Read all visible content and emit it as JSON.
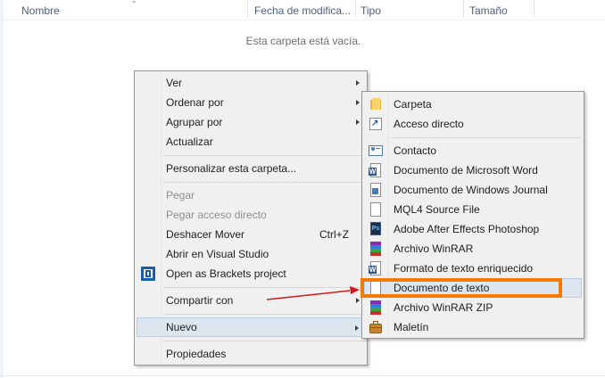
{
  "explorer": {
    "columns": [
      "Nombre",
      "Fecha de modifica...",
      "Tipo",
      "Tamaño"
    ],
    "empty_message": "Esta carpeta está vacía."
  },
  "context_menu": {
    "items": [
      {
        "label": "Ver",
        "submenu": true
      },
      {
        "label": "Ordenar por",
        "submenu": true
      },
      {
        "label": "Agrupar por",
        "submenu": true
      },
      {
        "label": "Actualizar"
      },
      {
        "label": "Personalizar esta carpeta..."
      },
      {
        "label": "Pegar",
        "disabled": true
      },
      {
        "label": "Pegar acceso directo",
        "disabled": true
      },
      {
        "label": "Deshacer Mover",
        "shortcut": "Ctrl+Z"
      },
      {
        "label": "Abrir en Visual Studio"
      },
      {
        "label": "Open as Brackets project",
        "icon": "brackets-icon"
      },
      {
        "label": "Compartir con",
        "submenu": true
      },
      {
        "label": "Nuevo",
        "submenu": true,
        "highlighted": true
      },
      {
        "label": "Propiedades"
      }
    ]
  },
  "new_submenu": {
    "items": [
      {
        "label": "Carpeta",
        "icon": "folder-icon"
      },
      {
        "label": "Acceso directo",
        "icon": "shortcut-icon"
      },
      {
        "label": "Contacto",
        "icon": "contact-icon"
      },
      {
        "label": "Documento de Microsoft Word",
        "icon": "word-document-icon"
      },
      {
        "label": "Documento de Windows Journal",
        "icon": "journal-document-icon"
      },
      {
        "label": "MQL4 Source File",
        "icon": "blank-document-icon"
      },
      {
        "label": "Adobe After Effects Photoshop",
        "icon": "photoshop-icon"
      },
      {
        "label": "Archivo WinRAR",
        "icon": "winrar-icon"
      },
      {
        "label": "Formato de texto enriquecido",
        "icon": "rtf-document-icon"
      },
      {
        "label": "Documento de texto",
        "icon": "text-document-icon",
        "highlighted": true
      },
      {
        "label": "Archivo WinRAR ZIP",
        "icon": "winrar-zip-icon"
      },
      {
        "label": "Maletín",
        "icon": "briefcase-icon"
      }
    ]
  },
  "colors": {
    "highlight_box": "#f47a00",
    "annotation_arrow": "#d11a1a",
    "menu_highlight": "#dde5ef"
  }
}
